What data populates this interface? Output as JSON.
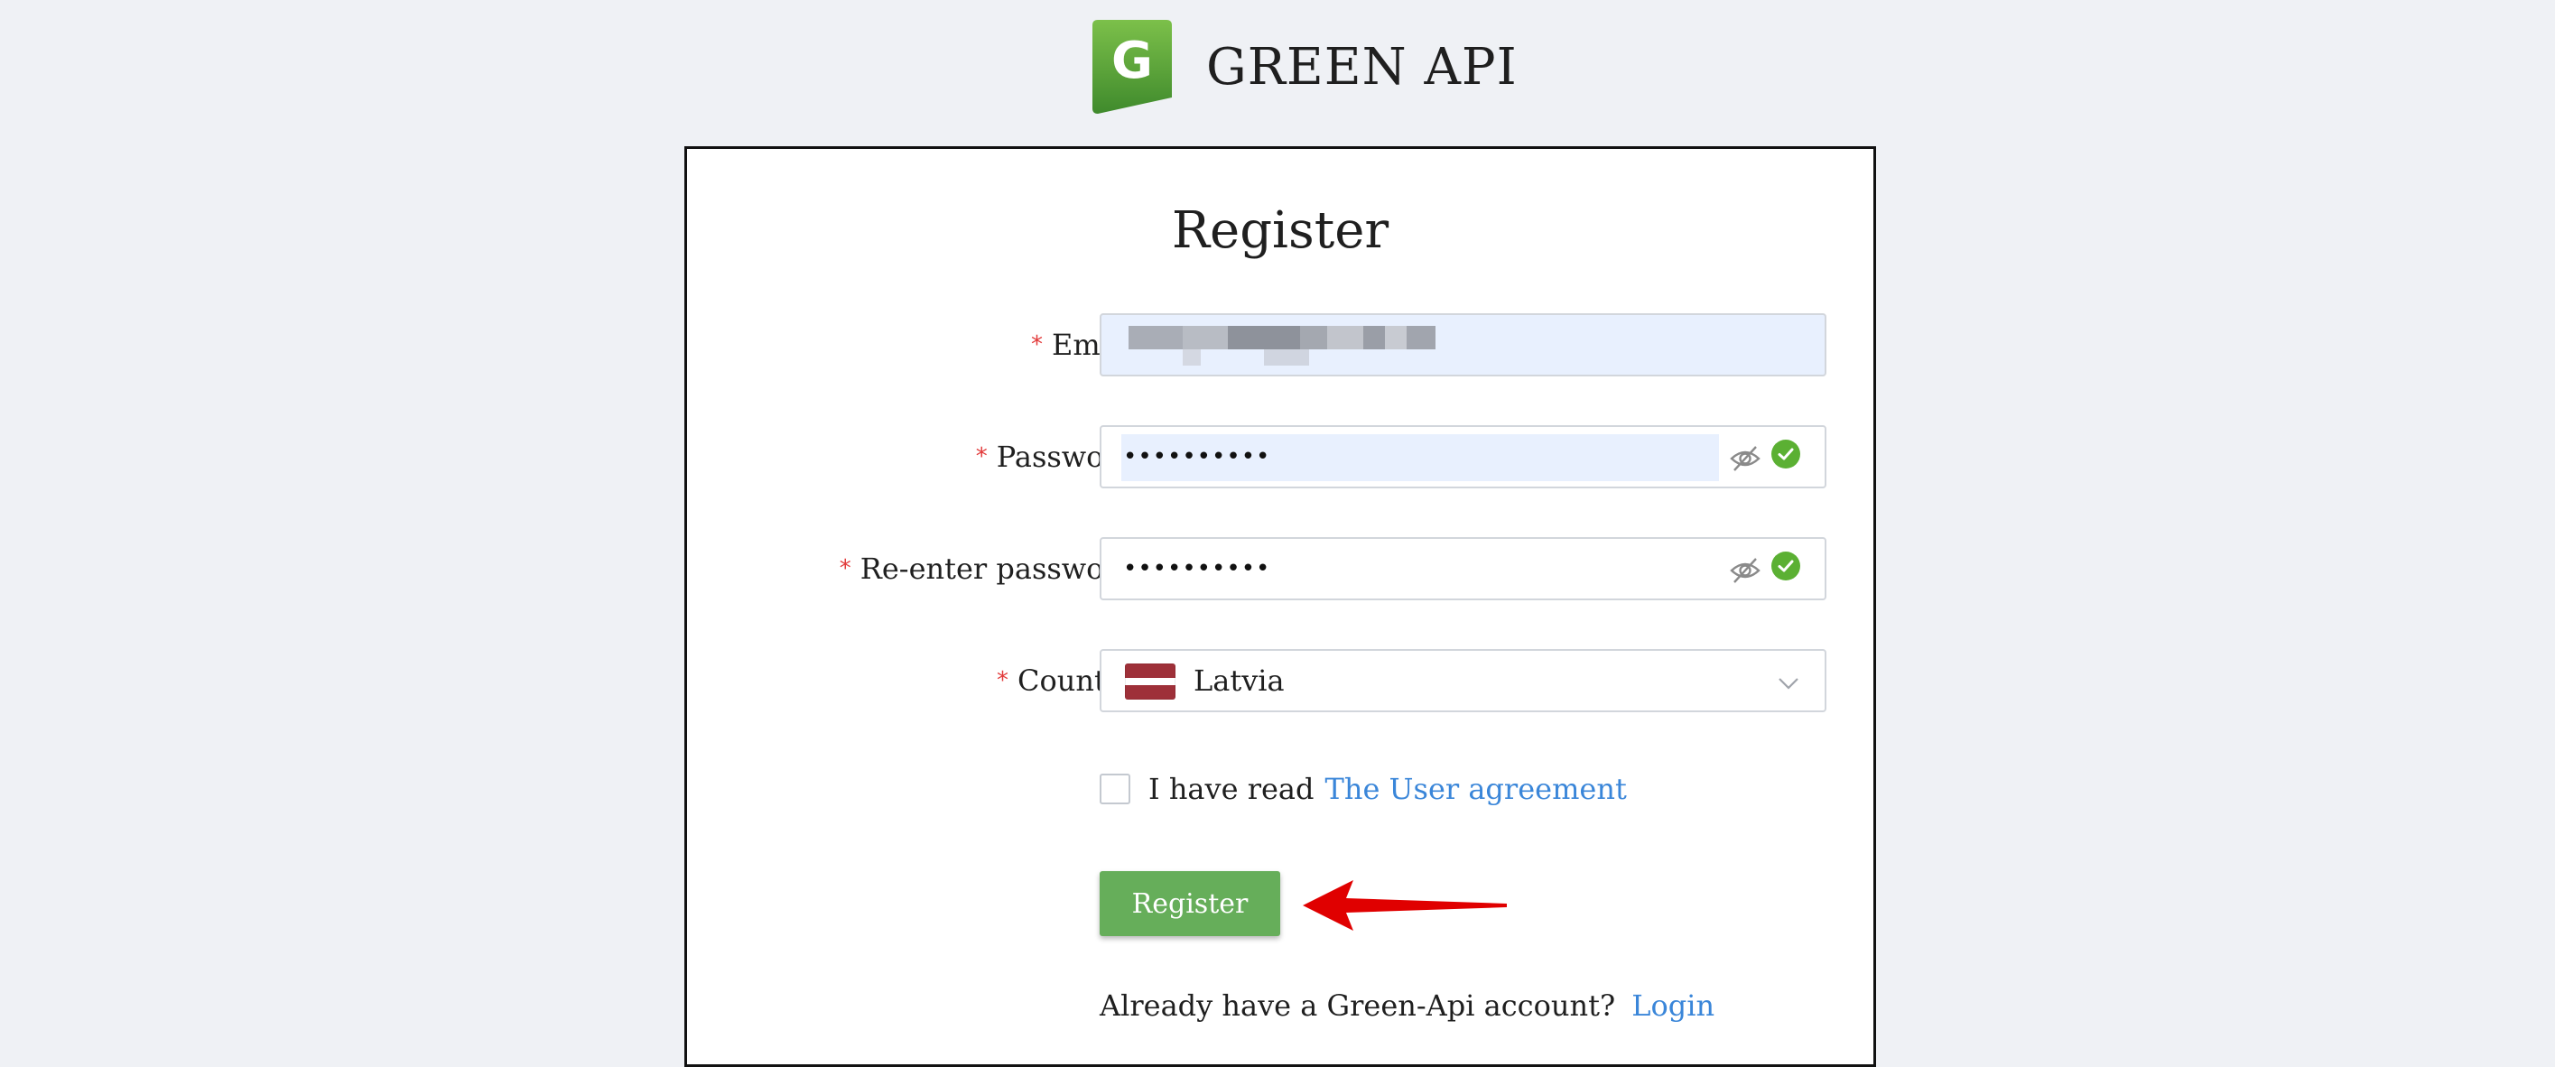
{
  "brand": {
    "logo_letter": "G",
    "name": "GREEN API"
  },
  "form": {
    "title": "Register",
    "required_mark": "*",
    "fields": {
      "email": {
        "label": "Email",
        "value": ""
      },
      "password": {
        "label": "Password",
        "value": "••••••••••"
      },
      "reenter_password": {
        "label": "Re-enter password",
        "value": "••••••••••"
      },
      "country": {
        "label": "Country",
        "value": "Latvia"
      }
    },
    "agreement": {
      "text": "I have read",
      "link": "The User agreement"
    },
    "submit_label": "Register",
    "footer": {
      "text": "Already have a Green-Api account?",
      "link": "Login"
    }
  },
  "icons": {
    "eye": "eye-off-icon",
    "check": "check-circle-icon",
    "flag": "latvia-flag-icon",
    "chevron": "chevron-down-icon",
    "annotation": "red-arrow-icon"
  },
  "colors": {
    "background": "#eff1f5",
    "brand_green": "#4f9a37",
    "button_green": "#66ae5a",
    "success_green": "#5bb033",
    "link_blue": "#3a86d9",
    "required_red": "#e23b3b",
    "autofill_blue": "#e8f0fe",
    "annotation_red": "#e00000",
    "latvia_red": "#9e3039"
  }
}
